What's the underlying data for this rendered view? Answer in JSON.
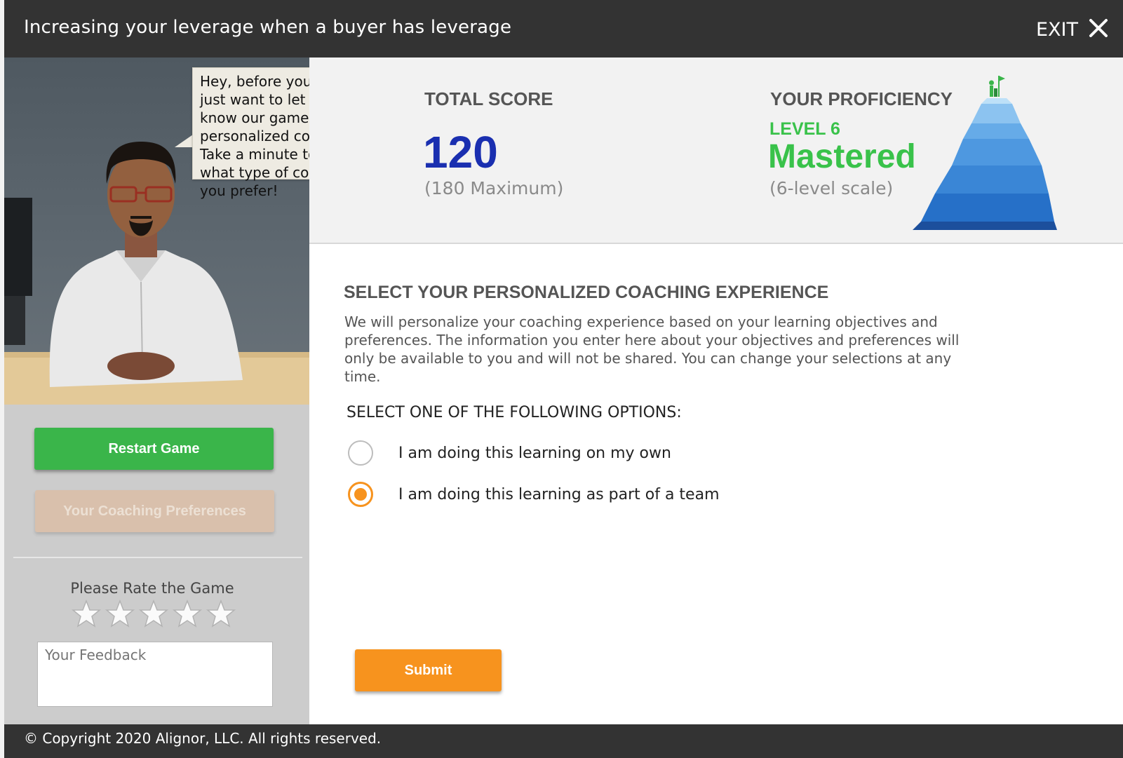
{
  "header": {
    "title": "Increasing your leverage when a buyer has leverage",
    "exit_label": "EXIT"
  },
  "left_panel": {
    "speech_bubble": "Hey, before you leave, just want to let you know our games include personalized coaching. Take a minute to tell us what type of coaching you prefer!",
    "restart_button": "Restart Game",
    "coaching_button": "Your Coaching Preferences",
    "rate_label": "Please Rate the Game",
    "rating": {
      "max": 5,
      "current": 0
    },
    "feedback_placeholder": "Your Feedback"
  },
  "score": {
    "heading": "TOTAL SCORE",
    "value": "120",
    "maximum": "(180 Maximum)"
  },
  "proficiency": {
    "heading": "YOUR PROFICIENCY",
    "level": "LEVEL 6",
    "status": "Mastered",
    "scale": "(6-level scale)",
    "level_number": 6,
    "levels_total": 6
  },
  "coaching": {
    "title": "SELECT YOUR PERSONALIZED COACHING EXPERIENCE",
    "description": "We will personalize your coaching experience based on your learning objectives and preferences. The information you enter here about your objectives and preferences will only be available to you and will not be shared. You can change your selections at any time.",
    "options_label": "SELECT ONE OF THE FOLLOWING OPTIONS:",
    "options": [
      {
        "label": "I am doing this learning on my own",
        "selected": false
      },
      {
        "label": "I am doing this learning as part of a team",
        "selected": true
      }
    ],
    "submit_label": "Submit"
  },
  "footer": {
    "copyright": "© Copyright 2020 Alignor, LLC. All rights reserved."
  },
  "colors": {
    "header_bg": "#333333",
    "score_blue": "#1a2fb0",
    "proficiency_green": "#39c24a",
    "restart_green": "#3ab54a",
    "accent_orange": "#f7931e",
    "coaching_disabled": "#d9c0ac"
  },
  "icons": {
    "exit": "close-icon",
    "rating": "star-icon",
    "proficiency": "mountain-icon"
  }
}
